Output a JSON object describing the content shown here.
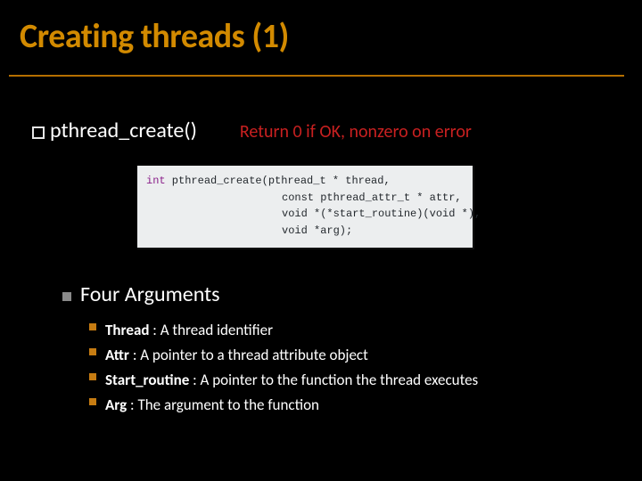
{
  "slide": {
    "title": "Creating threads (1)",
    "func": {
      "name": "pthread_create()",
      "return_note": "Return 0 if OK, nonzero on error"
    },
    "code": {
      "sig_open": "int pthread_create(pthread_t * thread,",
      "line2": "const pthread_attr_t * attr,",
      "line3": "void *(*start_routine)(void *),",
      "line4": "void *arg);"
    },
    "args_heading": "Four Arguments",
    "args": [
      {
        "name": "Thread",
        "desc": " : A thread identifier"
      },
      {
        "name": "Attr",
        "desc": " : A pointer to a thread attribute object"
      },
      {
        "name": "Start_routine",
        "desc": " : A pointer to the function the thread executes"
      },
      {
        "name": "Arg",
        "desc": " : The argument to the function"
      }
    ]
  }
}
